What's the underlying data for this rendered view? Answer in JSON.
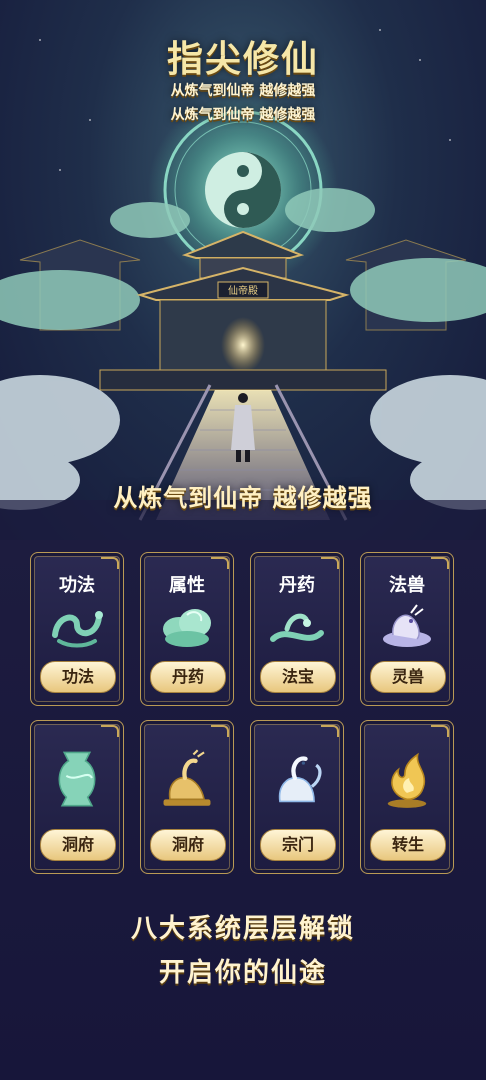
{
  "hero": {
    "title": "指尖修仙",
    "subtitle1": "从炼气到仙帝 越修越强",
    "subtitle2": "从炼气到仙帝 越修越强",
    "slogan": "从炼气到仙帝 越修越强",
    "plaque_text": "仙帝殿"
  },
  "cards": [
    {
      "label": "功法",
      "button": "功法",
      "icon": "jade-dragon-icon"
    },
    {
      "label": "属性",
      "button": "丹药",
      "icon": "jade-cloud-icon"
    },
    {
      "label": "丹药",
      "button": "法宝",
      "icon": "jade-serpent-icon"
    },
    {
      "label": "法兽",
      "button": "灵兽",
      "icon": "silver-dragon-icon"
    },
    {
      "label": "",
      "button": "洞府",
      "icon": "jade-vase-icon"
    },
    {
      "label": "",
      "button": "洞府",
      "icon": "golden-qilin-icon"
    },
    {
      "label": "",
      "button": "宗门",
      "icon": "white-qilin-icon"
    },
    {
      "label": "",
      "button": "转生",
      "icon": "golden-flame-icon"
    }
  ],
  "footer": {
    "line1": "八大系统层层解锁",
    "line2": "开启你的仙途"
  },
  "colors": {
    "background": "#1b1a3a",
    "gold": "#c9a85a",
    "jade": "#7fd1b5",
    "title": "#f6e7a8"
  }
}
